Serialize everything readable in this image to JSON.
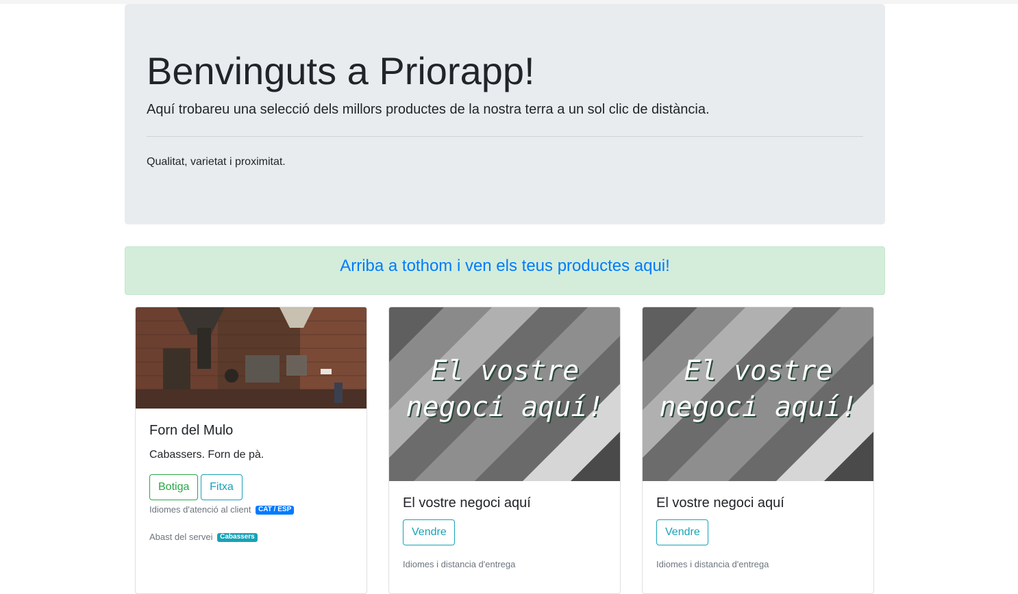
{
  "jumbotron": {
    "title": "Benvinguts a Priorapp!",
    "lead": "Aquí trobareu una selecció dels millors productes de la nostra terra a un sol clic de distància.",
    "text": "Qualitat, varietat i proximitat."
  },
  "alert": {
    "link_text": "Arriba a tothom i ven els teus productes aqui!"
  },
  "cards": [
    {
      "title": "Forn del Mulo",
      "text": "Cabassers. Forn de pà.",
      "buttons": [
        "Botiga",
        "Fitxa"
      ],
      "languages_label": "Idiomes d'atenció al client",
      "languages_badge": "CAT / ESP",
      "scope_label": "Abast del servei",
      "scope_badge": "Cabassers"
    },
    {
      "image_text": [
        "El vostre",
        "negoci aquí!"
      ],
      "title": "El vostre negoci aquí",
      "button": "Vendre",
      "note": "Idiomes i distancia d'entrega"
    },
    {
      "image_text": [
        "El vostre",
        "negoci aquí!"
      ],
      "title": "El vostre negoci aquí",
      "button": "Vendre",
      "note": "Idiomes i distancia d'entrega"
    }
  ],
  "colors": {
    "primary": "#007bff",
    "success": "#28a745",
    "info": "#17a2b8",
    "jumbotron_bg": "#e9ecef",
    "alert_bg": "#d4edda"
  }
}
